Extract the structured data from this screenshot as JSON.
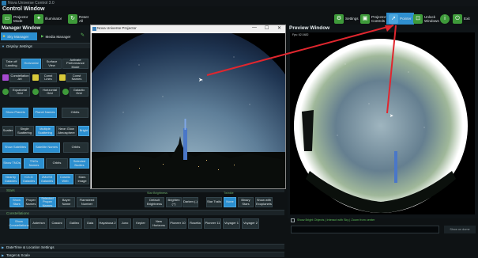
{
  "window": {
    "title": "Nova Universe Control 3.0",
    "heading": "Control Window"
  },
  "toolbar": {
    "projector_mode": "Projector Mode",
    "illuminator": "Illuminator",
    "reset_all": "Reset All",
    "settings": "Settings",
    "projector_controls": "Projector Controls",
    "pointer": "Pointer",
    "unlock_windows": "Unlock Windows",
    "info": "i",
    "exit": "Exit"
  },
  "manager": {
    "heading": "Manager Window",
    "sky_manager": "Sky Manager",
    "media_manager": "Media Manager"
  },
  "display_settings": {
    "header": "Display Settings",
    "row1": [
      "Take off Landing",
      "Horizontal",
      "Surface View",
      "Activate Performance Mode"
    ],
    "row2": [
      "Constellation Art",
      "Const Lines",
      "Const Names"
    ],
    "row3": [
      "Equatorial Grid",
      "Horizontal Grid",
      "Galactic Grid"
    ],
    "planets": [
      "Show Planets",
      "Planet Names",
      "Orbits"
    ],
    "scattering": [
      "Scatter",
      "Single Scattering",
      "Multiple Scattering",
      "Neon Glow Atmosphere",
      "Bright"
    ],
    "satellites": [
      "Show Satellites",
      "Satellite Names",
      "Orbits"
    ],
    "tnos": [
      "Show TNOs",
      "TNOs Names",
      "Orbits",
      "Selected Bodies"
    ],
    "nearby": [
      "Nearby Galaxies",
      "IC/LG Galaxies",
      "2MASS Galaxies",
      "Cosmic Web",
      "Mars Image"
    ]
  },
  "labels": {
    "stars": "Stars",
    "star_brightness": "Star Brightness",
    "twinkle": "Twinkle",
    "constellations": "Constellations",
    "milky_way": "Milky Way"
  },
  "stars_row": [
    "Show Stars",
    "Proper Names",
    "Selected Proper Names",
    "Bayer Name",
    "Flamsteed Number",
    "Default Brightness",
    "Brighten (+)",
    "Darken (-)",
    "Star Trails",
    "None",
    "Binary Stars",
    "Show with Exoplanets"
  ],
  "const_row": [
    "Show Constellations",
    "Asterism",
    "Cassini",
    "Galileo",
    "Gaia",
    "Hayabusa 2",
    "Juno",
    "Kepler",
    "New Horizons",
    "Pioneer 10",
    "Rosetta",
    "Pioneer 11",
    "Voyager 1",
    "Voyager 2"
  ],
  "bottom": {
    "datetime": "DateTime & Location Settings",
    "target": "Target & Scale"
  },
  "projector": {
    "title": "Nova Universe Projector",
    "controls": [
      "—",
      "☐",
      "✕"
    ]
  },
  "preview": {
    "title": "Preview Window",
    "fps": "Fps: 62.0482",
    "checkbox_label": "Show Bright Objects | Interact with Sky | Zoom from center",
    "show_on_dome": "Show on dome"
  },
  "colors": {
    "accent": "#2f8fcf",
    "green": "#3e9a3a",
    "arrow": "#e0262e"
  }
}
